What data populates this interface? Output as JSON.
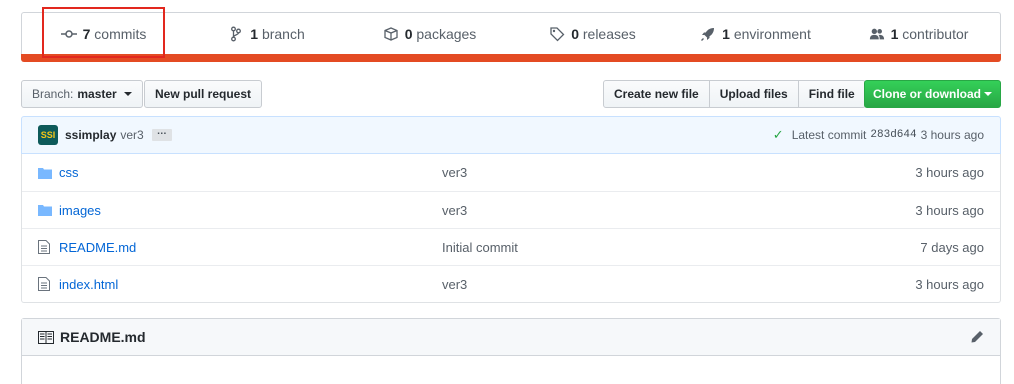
{
  "numbers": [
    {
      "count": "7",
      "label": "commits",
      "icon": "commit-icon"
    },
    {
      "count": "1",
      "label": "branch",
      "icon": "branch-icon"
    },
    {
      "count": "0",
      "label": "packages",
      "icon": "package-icon"
    },
    {
      "count": "0",
      "label": "releases",
      "icon": "tag-icon"
    },
    {
      "count": "1",
      "label": "environment",
      "icon": "rocket-icon"
    },
    {
      "count": "1",
      "label": "contributor",
      "icon": "people-icon"
    }
  ],
  "colors": {
    "language_bar": "#e44b23",
    "highlight": "#e2281e",
    "green": "#28a745",
    "link": "#0366d6"
  },
  "file_nav": {
    "branch_prefix": "Branch:",
    "branch_name": "master",
    "new_pr": "New pull request",
    "create_file": "Create new file",
    "upload_files": "Upload files",
    "find_file": "Find file",
    "clone": "Clone or download"
  },
  "commit": {
    "avatar_text": "SSI",
    "author": "ssimplay",
    "message": "ver3",
    "ellipsis": "…",
    "latest_label": "Latest commit",
    "sha": "283d644",
    "age": "3 hours ago"
  },
  "files": [
    {
      "name": "css",
      "type": "folder",
      "message": "ver3",
      "age": "3 hours ago"
    },
    {
      "name": "images",
      "type": "folder",
      "message": "ver3",
      "age": "3 hours ago"
    },
    {
      "name": "README.md",
      "type": "file",
      "message": "Initial commit",
      "age": "7 days ago"
    },
    {
      "name": "index.html",
      "type": "file",
      "message": "ver3",
      "age": "3 hours ago"
    }
  ],
  "readme": {
    "title": "README.md"
  }
}
